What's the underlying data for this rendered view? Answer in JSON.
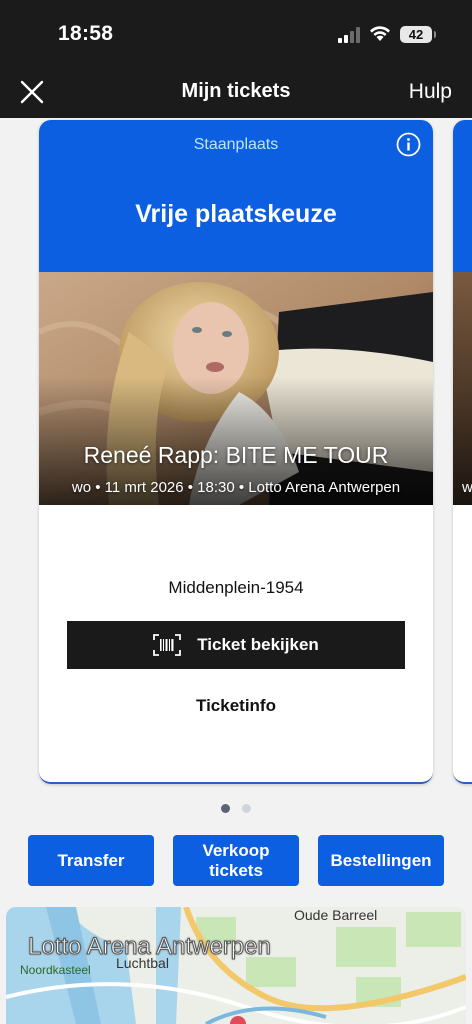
{
  "status_bar": {
    "time": "18:58",
    "battery": "42"
  },
  "nav": {
    "title": "Mijn tickets",
    "help": "Hulp"
  },
  "ticket": {
    "seat_type": "Staanplaats",
    "seat_title": "Vrije plaatskeuze",
    "event_name": "Reneé Rapp: BITE ME TOUR",
    "event_meta": "wo • 11 mrt 2026 • 18:30 • Lotto Arena Antwerpen",
    "seat_location": "Middenplein-1954",
    "view_ticket_label": "Ticket bekijken",
    "ticket_info_label": "Ticketinfo"
  },
  "next_card": {
    "meta_fragment": "w"
  },
  "pagination": {
    "pages": 2,
    "active": 1
  },
  "actions": {
    "transfer": "Transfer",
    "sell": "Verkoop tickets",
    "orders": "Bestellingen"
  },
  "map": {
    "title": "Lotto Arena Antwerpen",
    "labels": {
      "oude_barreel": "Oude Barreel",
      "luchtbal": "Luchtbal",
      "noordkasteel": "Noordkasteel"
    }
  },
  "colors": {
    "brand_blue": "#0b5fe0",
    "dark": "#1b1b1b",
    "button_dark": "#1a1a1a"
  }
}
